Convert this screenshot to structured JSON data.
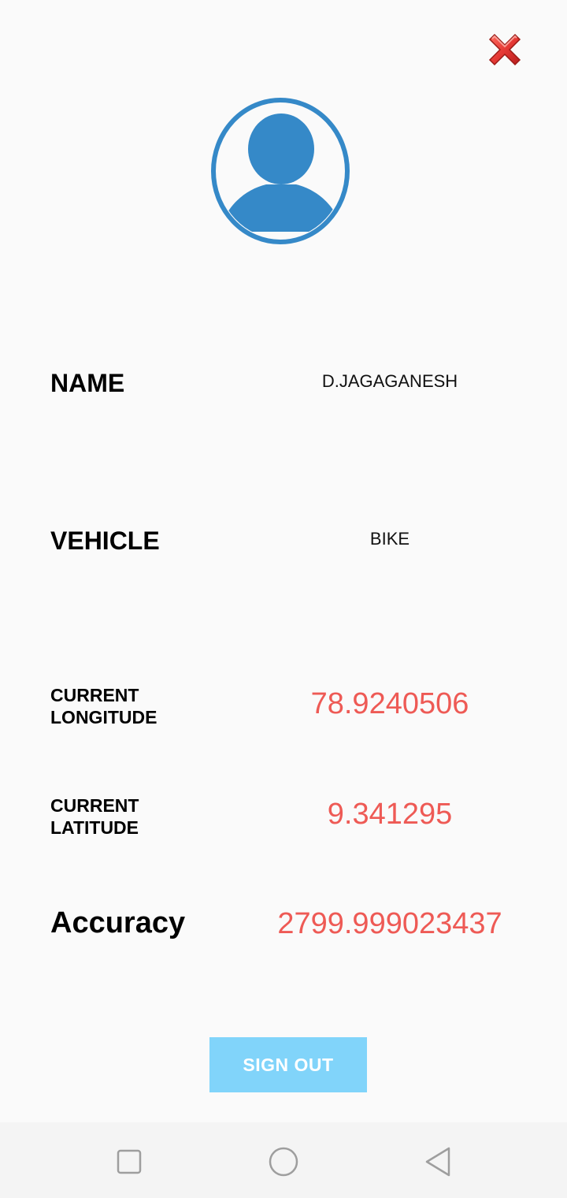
{
  "profile": {
    "name_label": "NAME",
    "name_value": "D.JAGAGANESH",
    "vehicle_label": "VEHICLE",
    "vehicle_value": "BIKE",
    "longitude_label_line1": "CURRENT",
    "longitude_label_line2": "LONGITUDE",
    "longitude_value": "78.9240506",
    "latitude_label_line1": "CURRENT",
    "latitude_label_line2": "LATITUDE",
    "latitude_value": "9.341295",
    "accuracy_label": "Accuracy",
    "accuracy_value": "2799.999023437"
  },
  "actions": {
    "signout_label": "SIGN OUT",
    "close_icon": "close-icon"
  },
  "icons": {
    "avatar": "user-avatar-icon",
    "nav_recent": "square-icon",
    "nav_home": "circle-icon",
    "nav_back": "triangle-back-icon"
  },
  "colors": {
    "background": "#fafafa",
    "value_red": "#ee5a55",
    "avatar_blue": "#3589c8",
    "button_blue": "#81d4fa",
    "close_red": "#e53935"
  }
}
